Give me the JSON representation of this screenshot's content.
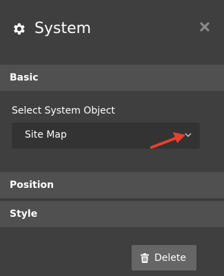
{
  "header": {
    "title": "System",
    "icon": "gear-icon",
    "close_icon": "close-icon"
  },
  "sections": {
    "basic": "Basic",
    "position": "Position",
    "style": "Style"
  },
  "basic": {
    "field_label": "Select System Object",
    "select_value": "Site Map",
    "select_icon": "chevron-down-icon"
  },
  "annotation": {
    "icon": "red-pointer-arrow-icon",
    "color": "#e8412c"
  },
  "actions": {
    "delete_label": "Delete",
    "delete_icon": "trash-icon"
  },
  "colors": {
    "background": "#3f3f3f",
    "section_bar": "#505050",
    "select_bg": "#333333",
    "button_bg": "#666666"
  }
}
